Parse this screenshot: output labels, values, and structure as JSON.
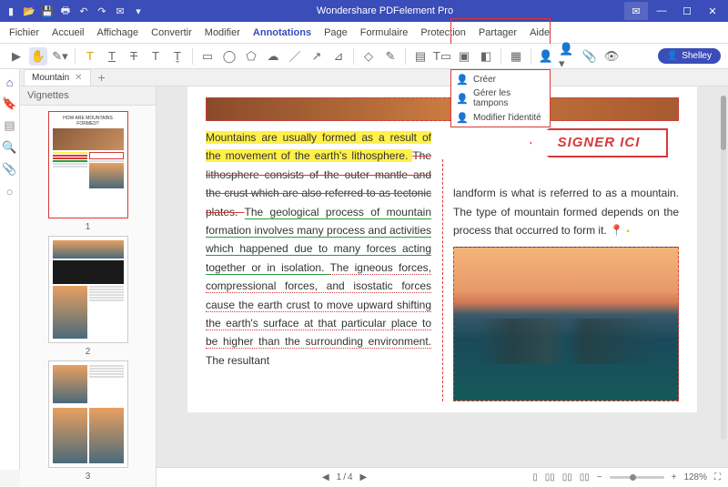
{
  "app": {
    "title": "Wondershare PDFelement Pro"
  },
  "menus": {
    "file": "Fichier",
    "home": "Accueil",
    "view": "Affichage",
    "convert": "Convertir",
    "edit": "Modifier",
    "annotations": "Annotations",
    "page": "Page",
    "form": "Formulaire",
    "protect": "Protection",
    "share": "Partager",
    "help": "Aide"
  },
  "user": {
    "name": "Shelley"
  },
  "tab": {
    "name": "Mountain"
  },
  "panel": {
    "title": "Vignettes"
  },
  "thumbs": {
    "n1": "1",
    "n2": "2",
    "n3": "3"
  },
  "dropdown": {
    "create": "Créer",
    "manage": "Gérer les tampons",
    "edit_identity": "Modifier l'identité"
  },
  "stamp": {
    "text": "SIGNER ICI"
  },
  "doc": {
    "p1a": "Mountains are usually formed as a result of the movement of the earth's lithosphere. ",
    "p1b": "The lithosphere consists of the outer mantle and the crust which are also referred to as tectonic plates. ",
    "p1c": "The geological process of mountain formation involves many process and activities which happened due to many forces acting together or in isolation. ",
    "p1d": "The igneous forces, compressional forces, and isostatic forces cause the earth crust to move upward shifting the earth's surface at that particular place to be higher than the surrounding environment. ",
    "p1e": "The resultant ",
    "p2a": "landform is what is referred to as a mountain. The type of mountain formed depends on the process that occurred to form it.  "
  },
  "status": {
    "page_current": "1",
    "page_sep": "/",
    "page_total": "4",
    "zoom": "128%"
  }
}
